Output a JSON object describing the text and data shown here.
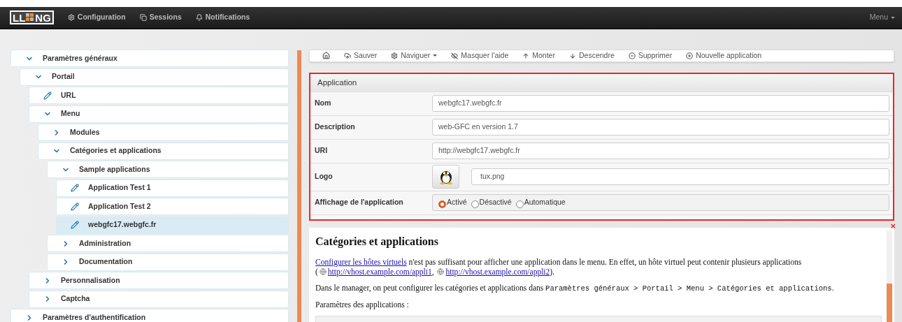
{
  "navbar": {
    "logo": {
      "left": "LL",
      "right": "NG"
    },
    "items": [
      {
        "label": "Configuration"
      },
      {
        "label": "Sessions"
      },
      {
        "label": "Notifications"
      }
    ],
    "menu": "Menu"
  },
  "tree": [
    {
      "label": "Paramètres généraux",
      "kind": "node",
      "expanded": true,
      "selected": false,
      "children": [
        {
          "label": "Portail",
          "kind": "node",
          "expanded": true,
          "selected": false,
          "children": [
            {
              "label": "URL",
              "kind": "leaf",
              "selected": false
            },
            {
              "label": "Menu",
              "kind": "node",
              "expanded": true,
              "selected": false,
              "children": [
                {
                  "label": "Modules",
                  "kind": "node",
                  "expanded": false,
                  "selected": false
                },
                {
                  "label": "Catégories et applications",
                  "kind": "node",
                  "expanded": true,
                  "selected": false,
                  "children": [
                    {
                      "label": "Sample applications",
                      "kind": "node",
                      "expanded": true,
                      "selected": false,
                      "children": [
                        {
                          "label": "Application Test 1",
                          "kind": "leaf",
                          "selected": false
                        },
                        {
                          "label": "Application Test 2",
                          "kind": "leaf",
                          "selected": false
                        },
                        {
                          "label": "webgfc17.webgfc.fr",
                          "kind": "leaf",
                          "selected": true
                        }
                      ]
                    },
                    {
                      "label": "Administration",
                      "kind": "node",
                      "expanded": false,
                      "selected": false
                    },
                    {
                      "label": "Documentation",
                      "kind": "node",
                      "expanded": false,
                      "selected": false
                    }
                  ]
                }
              ]
            },
            {
              "label": "Personnalisation",
              "kind": "node",
              "expanded": false,
              "selected": false
            },
            {
              "label": "Captcha",
              "kind": "node",
              "expanded": false,
              "selected": false
            }
          ]
        }
      ]
    },
    {
      "label": "Paramètres d'authentification",
      "kind": "node",
      "expanded": false,
      "selected": false
    }
  ],
  "toolbar": [
    {
      "label": "Sauver",
      "dropdown": false
    },
    {
      "label": "Naviguer",
      "dropdown": true
    },
    {
      "label": "Masquer l'aide",
      "dropdown": false
    },
    {
      "label": "Monter",
      "dropdown": false
    },
    {
      "label": "Descendre",
      "dropdown": false
    },
    {
      "label": "Supprimer",
      "dropdown": false
    },
    {
      "label": "Nouvelle application",
      "dropdown": false
    }
  ],
  "form": {
    "title": "Application",
    "fields": [
      {
        "label": "Nom",
        "kind": "text",
        "value": "webgfc17.webgfc.fr"
      },
      {
        "label": "Description",
        "kind": "text",
        "value": "web-GFC en version 1.7"
      },
      {
        "label": "URI",
        "kind": "text",
        "value": "http://webgfc17.webgfc.fr"
      },
      {
        "label": "Logo",
        "kind": "logo",
        "value": "tux.png"
      },
      {
        "label": "Affichage de l'application",
        "kind": "radio",
        "options": [
          {
            "label": "Activé",
            "selected": true
          },
          {
            "label": "Désactivé",
            "selected": false
          },
          {
            "label": "Automatique",
            "selected": false
          }
        ]
      }
    ]
  },
  "help": {
    "close": "×",
    "title": "Catégories et applications",
    "paragraphs": [
      [
        {
          "kind": "link",
          "text": "Configurer les hôtes virtuels"
        },
        {
          "kind": "text",
          "text": " n'est pas suffisant pour afficher une application dans le menu. En effet, un hôte virtuel peut contenir plusieurs applications"
        },
        {
          "kind": "break"
        },
        {
          "kind": "text",
          "text": "("
        },
        {
          "kind": "globe"
        },
        {
          "kind": "link",
          "text": "http://vhost.example.com/appli1"
        },
        {
          "kind": "text",
          "text": ", "
        },
        {
          "kind": "globe"
        },
        {
          "kind": "link",
          "text": "http://vhost.example.com/appli2"
        },
        {
          "kind": "text",
          "text": ")."
        }
      ],
      [
        {
          "kind": "text",
          "text": "Dans le manager, on peut configurer les catégories et applications dans "
        },
        {
          "kind": "code",
          "text": "Paramètres généraux > Portail > Menu > Catégories et applications"
        },
        {
          "kind": "text",
          "text": "."
        }
      ],
      [
        {
          "kind": "text",
          "text": "Paramètres des applications :"
        }
      ]
    ]
  }
}
